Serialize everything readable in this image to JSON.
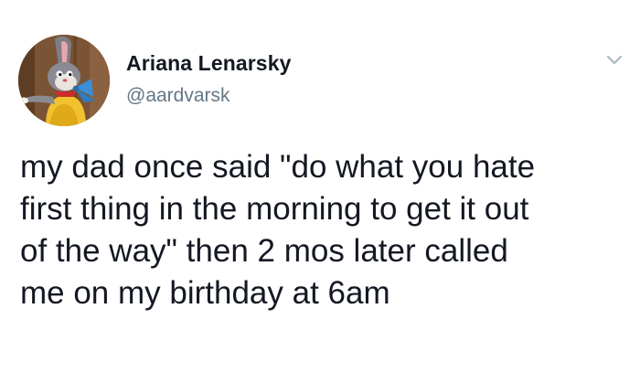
{
  "tweet": {
    "author": {
      "display_name": "Ariana Lenarsky",
      "handle": "@aardvarsk",
      "avatar_icon": "cartoon-bunny-avatar"
    },
    "menu_icon": "chevron-down-icon",
    "text_lines": [
      "my dad once said \"do what you hate",
      "first thing in the morning to get it out",
      "of the way\" then 2 mos later called",
      "me on my birthday at 6am"
    ]
  },
  "colors": {
    "text": "#141823",
    "secondary_text": "#657786",
    "background": "#ffffff"
  }
}
